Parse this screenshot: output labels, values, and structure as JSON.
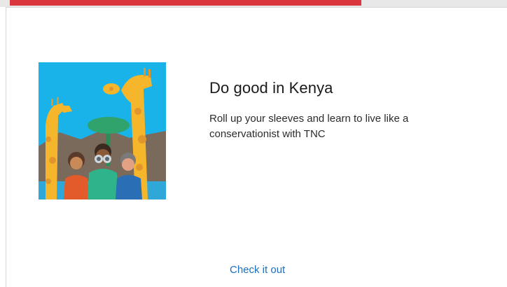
{
  "colors": {
    "accent_bar": "#d9363e",
    "link": "#1a6fc4",
    "title": "#1a1a1a",
    "sky": "#19b3ea",
    "giraffe": "#f5b62c"
  },
  "card": {
    "illustration": "people-with-giraffes",
    "title": "Do good in Kenya",
    "description": "Roll up your sleeves and learn to live like a conservationist with TNC",
    "cta_label": "Check it out"
  }
}
